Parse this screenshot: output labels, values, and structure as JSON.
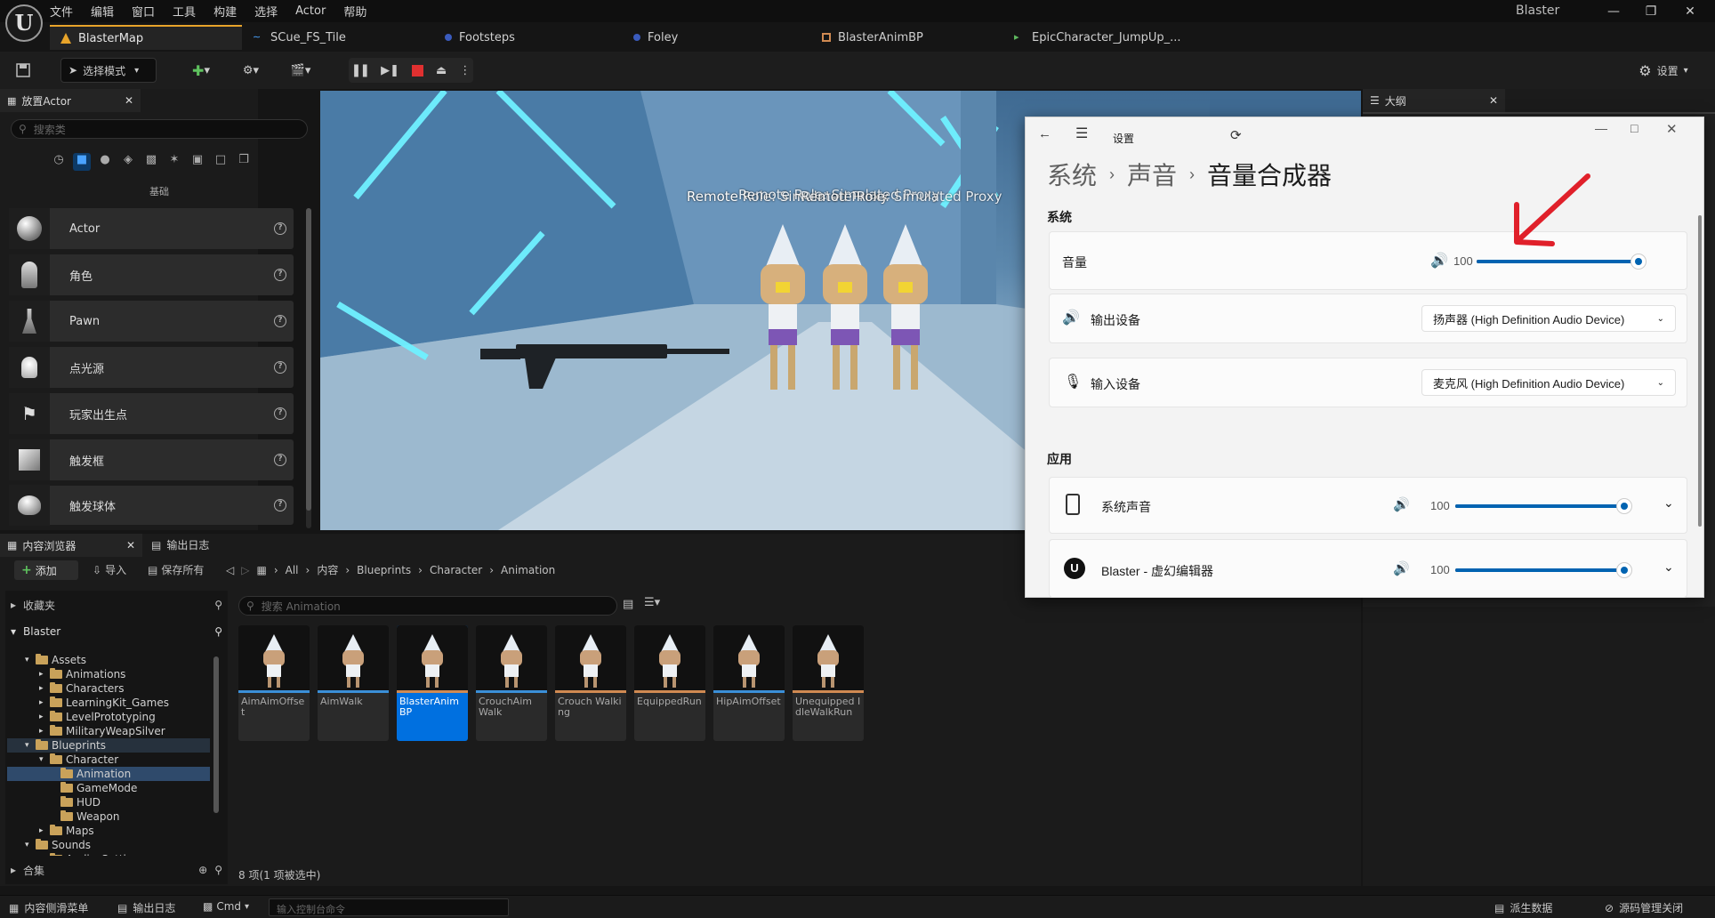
{
  "app": {
    "window_title": "Blaster",
    "logo": "U"
  },
  "menu": [
    "文件",
    "编辑",
    "窗口",
    "工具",
    "构建",
    "选择",
    "Actor",
    "帮助"
  ],
  "doc_tabs": [
    {
      "label": "BlasterMap",
      "icon": "level-icon"
    },
    {
      "label": "SCue_FS_Tile",
      "icon": "soundcue-icon"
    },
    {
      "label": "Footsteps",
      "icon": "soundclass-icon"
    },
    {
      "label": "Foley",
      "icon": "soundclass-icon"
    },
    {
      "label": "BlasterAnimBP",
      "icon": "animbp-icon"
    },
    {
      "label": "EpicCharacter_JumpUp_...",
      "icon": "animseq-icon"
    }
  ],
  "toolbar": {
    "mode_label": "选择模式",
    "settings_label": "设置"
  },
  "place_actor": {
    "tab_label": "放置Actor",
    "search_placeholder": "搜索类",
    "category_label": "基础",
    "items": [
      {
        "label": "Actor"
      },
      {
        "label": "角色"
      },
      {
        "label": "Pawn"
      },
      {
        "label": "点光源"
      },
      {
        "label": "玩家出生点"
      },
      {
        "label": "触发框"
      },
      {
        "label": "触发球体"
      }
    ]
  },
  "viewport": {
    "overlay_text": "Remote Role: Simulated Proxy",
    "overlay_text_2": "Remote Role: Simulated Proxy",
    "overlay_text_3": "Remote Role: Simulated Proxy"
  },
  "outline": {
    "tab_label": "大纲"
  },
  "settings_window": {
    "title": "设置",
    "breadcrumb": [
      "系统",
      "声音",
      "音量合成器"
    ],
    "section_system": "系统",
    "volume_label": "音量",
    "volume_value": "100",
    "volume_level": 1.0,
    "output_label": "输出设备",
    "output_value": "扬声器 (High Definition Audio Device)",
    "input_label": "输入设备",
    "input_value": "麦克风 (High Definition Audio Device)",
    "section_apps": "应用",
    "apps": [
      {
        "name": "系统声音",
        "value": "100",
        "level": 1.0
      },
      {
        "name": "Blaster - 虚幻编辑器",
        "value": "100",
        "level": 1.0
      }
    ],
    "accent_color": "#0063b1",
    "arrow_color": "#e0202a"
  },
  "content_browser": {
    "tab_label": "内容浏览器",
    "log_tab_label": "输出日志",
    "add_label": "添加",
    "import_label": "导入",
    "save_all_label": "保存所有",
    "path": [
      "All",
      "内容",
      "Blueprints",
      "Character",
      "Animation"
    ],
    "favorites_label": "收藏夹",
    "project_label": "Blaster",
    "search_placeholder": "搜索 Animation",
    "collections_label": "合集",
    "count_label": "8 项(1 项被选中)",
    "tree": [
      {
        "label": "Assets",
        "depth": 1,
        "expanded": true
      },
      {
        "label": "Animations",
        "depth": 2
      },
      {
        "label": "Characters",
        "depth": 2
      },
      {
        "label": "LearningKit_Games",
        "depth": 2
      },
      {
        "label": "LevelPrototyping",
        "depth": 2
      },
      {
        "label": "MilitaryWeapSilver",
        "depth": 2
      },
      {
        "label": "Blueprints",
        "depth": 1,
        "expanded": true
      },
      {
        "label": "Character",
        "depth": 2,
        "expanded": true
      },
      {
        "label": "Animation",
        "depth": 3,
        "selected": true
      },
      {
        "label": "GameMode",
        "depth": 3
      },
      {
        "label": "HUD",
        "depth": 3
      },
      {
        "label": "Weapon",
        "depth": 3
      },
      {
        "label": "Maps",
        "depth": 2
      },
      {
        "label": "Sounds",
        "depth": 1,
        "expanded": true
      },
      {
        "label": "Audio_Settings",
        "depth": 2
      }
    ],
    "assets": [
      {
        "name": "AimAimOffset",
        "kind": "blue"
      },
      {
        "name": "AimWalk",
        "kind": "blue"
      },
      {
        "name": "BlasterAnim BP",
        "kind": "selected"
      },
      {
        "name": "CrouchAim Walk",
        "kind": "blue"
      },
      {
        "name": "Crouch Walking",
        "kind": "orange"
      },
      {
        "name": "EquippedRun",
        "kind": "orange"
      },
      {
        "name": "HipAimOffset",
        "kind": "blue"
      },
      {
        "name": "Unequipped IdleWalkRun",
        "kind": "orange"
      }
    ]
  },
  "status_bar": {
    "drawer_label": "内容侧滑菜单",
    "log_label": "输出日志",
    "cmd_label": "Cmd",
    "console_placeholder": "输入控制台命令",
    "derived_label": "派生数据",
    "source_label": "源码管理关闭"
  }
}
